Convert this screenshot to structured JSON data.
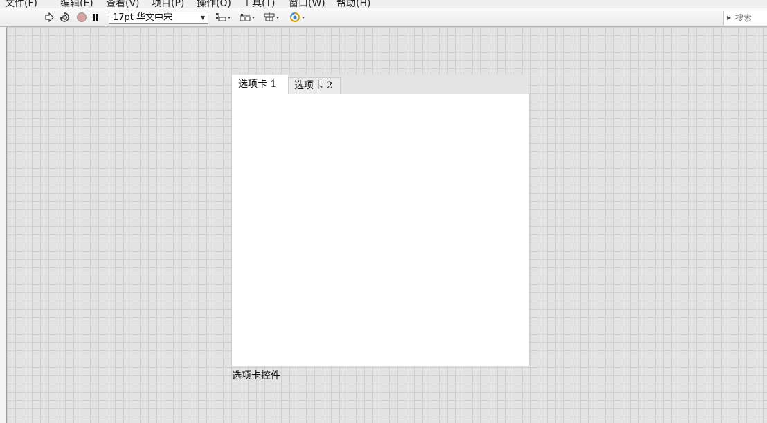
{
  "menu": {
    "items": [
      "文件(F)",
      "编辑(E)",
      "查看(V)",
      "项目(P)",
      "操作(O)",
      "工具(T)",
      "窗口(W)",
      "帮助(H)"
    ]
  },
  "toolbar": {
    "font_selector": "17pt 华文中宋",
    "search_placeholder": "搜索",
    "icons": [
      "run-arrow-icon",
      "run-continuously-icon",
      "abort-icon",
      "pause-icon",
      "align-objects-icon",
      "distribute-objects-icon",
      "resize-objects-icon",
      "reorder-icon"
    ]
  },
  "tab_control": {
    "tabs": [
      {
        "label": "选项卡 1",
        "active": true
      },
      {
        "label": "选项卡 2",
        "active": false
      }
    ],
    "caption": "选项卡控件"
  },
  "colors": {
    "canvas_bg": "#e3e3e3",
    "grid_line": "#cfcfcf",
    "abort_button": "#d8a0a0",
    "reorder_icon": "#d6a000"
  }
}
